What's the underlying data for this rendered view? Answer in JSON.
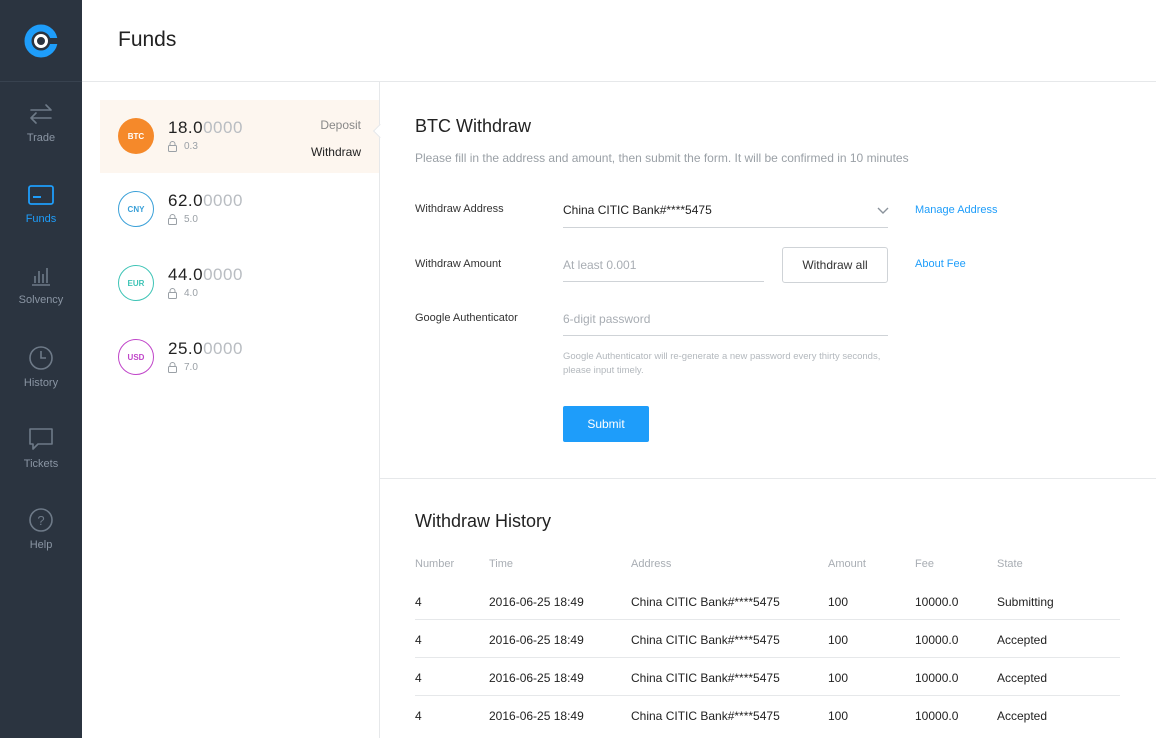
{
  "nav": {
    "items": [
      {
        "label": "Trade",
        "icon": "arrows-icon"
      },
      {
        "label": "Funds",
        "icon": "wallet-icon"
      },
      {
        "label": "Solvency",
        "icon": "bar-chart-icon"
      },
      {
        "label": "History",
        "icon": "clock-icon"
      },
      {
        "label": "Tickets",
        "icon": "message-icon"
      },
      {
        "label": "Help",
        "icon": "help-icon"
      }
    ]
  },
  "header": {
    "title": "Funds"
  },
  "assets": [
    {
      "code": "BTC",
      "balance_main": "18.0",
      "balance_tail": "0000",
      "locked": "0.3",
      "color": "#f5892a"
    },
    {
      "code": "CNY",
      "balance_main": "62.0",
      "balance_tail": "0000",
      "locked": "5.0",
      "color": "#3aa0d8"
    },
    {
      "code": "EUR",
      "balance_main": "44.0",
      "balance_tail": "0000",
      "locked": "4.0",
      "color": "#3ec4b6"
    },
    {
      "code": "USD",
      "balance_main": "25.0",
      "balance_tail": "0000",
      "locked": "7.0",
      "color": "#c045c9"
    }
  ],
  "asset_actions": {
    "deposit": "Deposit",
    "withdraw": "Withdraw"
  },
  "form": {
    "title": "BTC Withdraw",
    "description": "Please fill in the address and amount, then submit the form. It will be confirmed in 10 minutes",
    "address_label": "Withdraw Address",
    "address_value": "China CITIC Bank#****5475",
    "manage_address": "Manage Address",
    "amount_label": "Withdraw Amount",
    "amount_placeholder": "At least 0.001",
    "withdraw_all": "Withdraw all",
    "about_fee": "About Fee",
    "ga_label": "Google Authenticator",
    "ga_placeholder": "6-digit password",
    "ga_hint": "Google Authenticator will re-generate a new password every thirty seconds, please input timely.",
    "submit": "Submit"
  },
  "history": {
    "title": "Withdraw History",
    "columns": [
      "Number",
      "Time",
      "Address",
      "Amount",
      "Fee",
      "State"
    ],
    "rows": [
      [
        "4",
        "2016-06-25 18:49",
        "China CITIC Bank#****5475",
        "100",
        "10000.0",
        "Submitting"
      ],
      [
        "4",
        "2016-06-25 18:49",
        "China CITIC Bank#****5475",
        "100",
        "10000.0",
        "Accepted"
      ],
      [
        "4",
        "2016-06-25 18:49",
        "China CITIC Bank#****5475",
        "100",
        "10000.0",
        "Accepted"
      ],
      [
        "4",
        "2016-06-25 18:49",
        "China CITIC Bank#****5475",
        "100",
        "10000.0",
        "Accepted"
      ]
    ]
  }
}
